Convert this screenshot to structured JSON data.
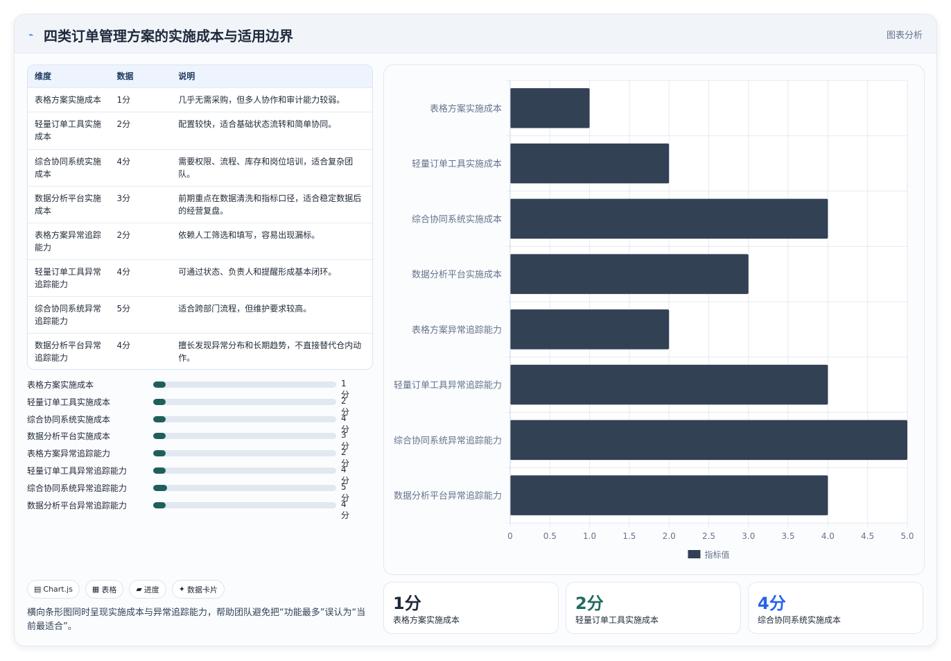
{
  "header": {
    "icon": "pulse-icon",
    "title": "四类订单管理方案的实施成本与适用边界",
    "right_label": "图表分析"
  },
  "table": {
    "headers": [
      "维度",
      "数据",
      "说明"
    ],
    "rows": [
      [
        "表格方案实施成本",
        "1分",
        "几乎无需采购，但多人协作和审计能力较弱。"
      ],
      [
        "轻量订单工具实施成本",
        "2分",
        "配置较快，适合基础状态流转和简单协同。"
      ],
      [
        "综合协同系统实施成本",
        "4分",
        "需要权限、流程、库存和岗位培训，适合复杂团队。"
      ],
      [
        "数据分析平台实施成本",
        "3分",
        "前期重点在数据清洗和指标口径，适合稳定数据后的经营复盘。"
      ],
      [
        "表格方案异常追踪能力",
        "2分",
        "依赖人工筛选和填写，容易出现漏标。"
      ],
      [
        "轻量订单工具异常追踪能力",
        "4分",
        "可通过状态、负责人和提醒形成基本闭环。"
      ],
      [
        "综合协同系统异常追踪能力",
        "5分",
        "适合跨部门流程，但维护要求较高。"
      ],
      [
        "数据分析平台异常追踪能力",
        "4分",
        "擅长发现异常分布和长期趋势，不直接替代仓内动作。"
      ]
    ]
  },
  "progress": {
    "max": 5,
    "items": [
      {
        "label": "表格方案实施成本",
        "value": 1,
        "display": "1分"
      },
      {
        "label": "轻量订单工具实施成本",
        "value": 2,
        "display": "2分"
      },
      {
        "label": "综合协同系统实施成本",
        "value": 4,
        "display": "4分"
      },
      {
        "label": "数据分析平台实施成本",
        "value": 3,
        "display": "3分"
      },
      {
        "label": "表格方案异常追踪能力",
        "value": 2,
        "display": "2分"
      },
      {
        "label": "轻量订单工具异常追踪能力",
        "value": 4,
        "display": "4分"
      },
      {
        "label": "综合协同系统异常追踪能力",
        "value": 5,
        "display": "5分"
      },
      {
        "label": "数据分析平台异常追踪能力",
        "value": 4,
        "display": "4分"
      }
    ]
  },
  "chips": [
    {
      "icon": "chart-icon",
      "glyph": "▤",
      "label": "Chart.js"
    },
    {
      "icon": "table-icon",
      "glyph": "▦",
      "label": "表格"
    },
    {
      "icon": "progress-icon",
      "glyph": "▰",
      "label": "进度"
    },
    {
      "icon": "sparkle-icon",
      "glyph": "✦",
      "label": "数据卡片"
    }
  ],
  "note": "横向条形图同时呈现实施成本与异常追踪能力，帮助团队避免把“功能最多”误认为“当前最适合”。",
  "stats": [
    {
      "value": "1分",
      "label": "表格方案实施成本",
      "color": "#1e293b"
    },
    {
      "value": "2分",
      "label": "轻量订单工具实施成本",
      "color": "#1f6b5e"
    },
    {
      "value": "4分",
      "label": "综合协同系统实施成本",
      "color": "#2563eb"
    }
  ],
  "chart_data": {
    "type": "bar",
    "orientation": "horizontal",
    "categories": [
      "表格方案实施成本",
      "轻量订单工具实施成本",
      "综合协同系统实施成本",
      "数据分析平台实施成本",
      "表格方案异常追踪能力",
      "轻量订单工具异常追踪能力",
      "综合协同系统异常追踪能力",
      "数据分析平台异常追踪能力"
    ],
    "series": [
      {
        "name": "指标值",
        "values": [
          1,
          2,
          4,
          3,
          2,
          4,
          5,
          4
        ],
        "color": "#334155"
      }
    ],
    "xlim": [
      0,
      5
    ],
    "xticks": [
      "0",
      "0.5",
      "1.0",
      "1.5",
      "2.0",
      "2.5",
      "3.0",
      "3.5",
      "4.0",
      "4.5",
      "5.0"
    ],
    "grid": true,
    "legend": "bottom"
  }
}
